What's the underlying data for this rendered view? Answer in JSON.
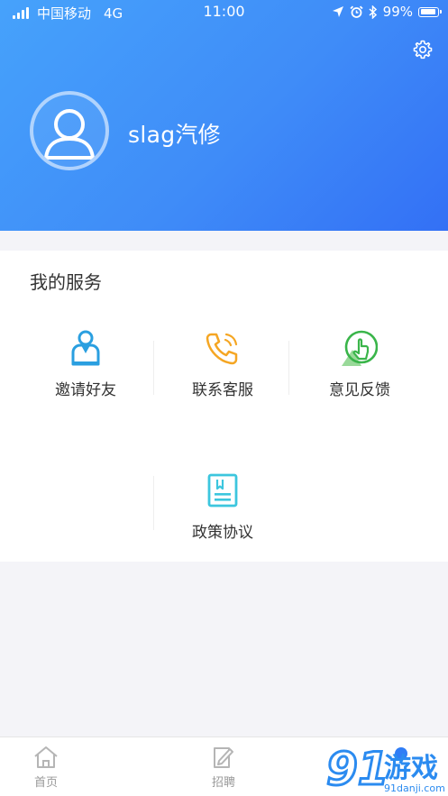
{
  "status_bar": {
    "carrier": "中国移动",
    "network": "4G",
    "time": "11:00",
    "battery": "99%",
    "battery_level": 0.99
  },
  "profile": {
    "username": "slag汽修",
    "avatar_icon": "user-avatar-icon",
    "settings_icon": "gear-icon"
  },
  "services": {
    "title": "我的服务",
    "items": [
      {
        "label": "邀请好友",
        "icon": "invite-friend-icon",
        "color": "#2a9fe0"
      },
      {
        "label": "联系客服",
        "icon": "phone-service-icon",
        "color": "#f5a623"
      },
      {
        "label": "意见反馈",
        "icon": "feedback-icon",
        "color": "#3ab54a"
      },
      {
        "label": "政策协议",
        "icon": "policy-document-icon",
        "color": "#3cc6de"
      }
    ]
  },
  "tabbar": {
    "items": [
      {
        "label": "首页",
        "icon": "home-icon"
      },
      {
        "label": "招聘",
        "icon": "recruit-icon"
      }
    ]
  },
  "watermark": {
    "brand": "91",
    "text": "游戏",
    "site": "91danji.com"
  },
  "colors": {
    "header_start": "#46a2fb",
    "header_end": "#3370f5",
    "tab_inactive": "#999999",
    "accent": "#2f7df6"
  }
}
